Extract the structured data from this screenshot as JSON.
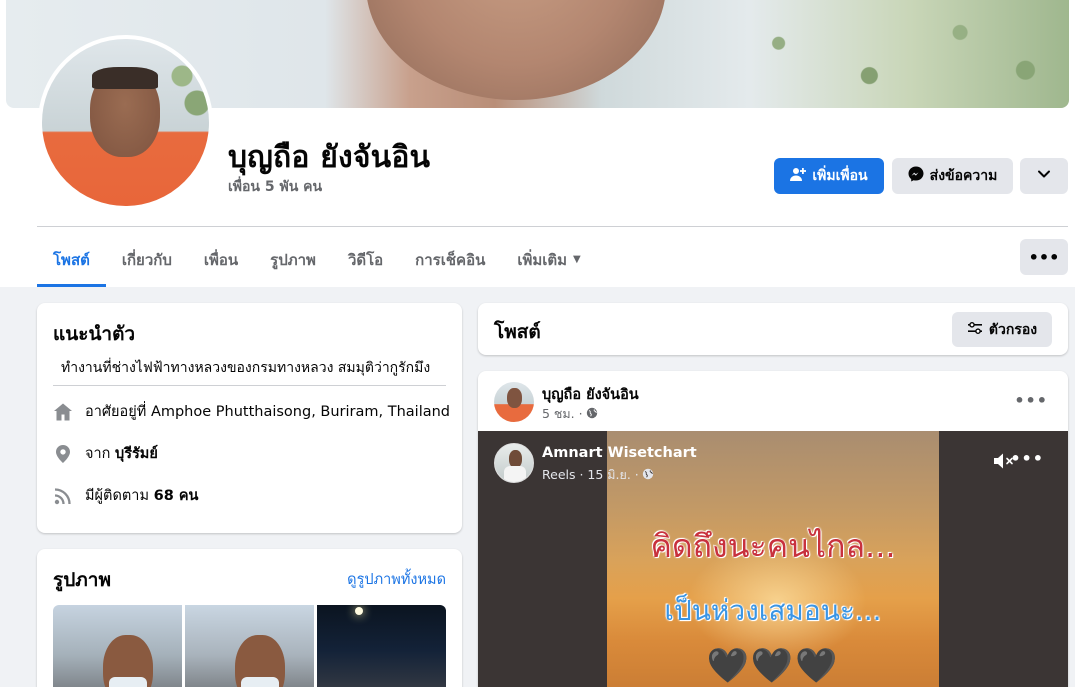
{
  "profile": {
    "name": "บุญถือ ยังจันอิน",
    "friends_count": "เพื่อน 5 พัน คน",
    "add_friend_label": "เพิ่มเพื่อน",
    "message_label": "ส่งข้อความ"
  },
  "tabs": [
    {
      "label": "โพสต์",
      "active": true
    },
    {
      "label": "เกี่ยวกับ"
    },
    {
      "label": "เพื่อน"
    },
    {
      "label": "รูปภาพ"
    },
    {
      "label": "วิดีโอ"
    },
    {
      "label": "การเช็คอิน"
    },
    {
      "label": "เพิ่มเติม"
    }
  ],
  "intro": {
    "title": "แนะนำตัว",
    "bio": "ทำงานที่ช่างไฟฟ้าทางหลวงของกรมทางหลวง สมมุติว่ากูรักมึง",
    "lives_prefix": "อาศัยอยู่ที่",
    "lives_place": "Amphoe Phutthaisong, Buriram, Thailand",
    "from_prefix": "จาก",
    "from_place": "บุรีรัมย์",
    "followers_prefix": "มีผู้ติดตาม",
    "followers_count": "68 คน"
  },
  "photos": {
    "title": "รูปภาพ",
    "see_all": "ดูรูปภาพทั้งหมด"
  },
  "posts_header": {
    "title": "โพสต์",
    "filter_label": "ตัวกรอง"
  },
  "post": {
    "author": "บุญถือ ยังจันอิน",
    "time": "5 ชม. ·",
    "reel": {
      "author": "Amnart Wisetchart",
      "meta": "Reels · 15 มิ.ย. ·",
      "line1": "คิดถึงนะคนไกล...",
      "line2": "เป็นห่วงเสมอนะ...",
      "hearts": "🖤🖤🖤"
    }
  },
  "colors": {
    "accent": "#1b74e4",
    "page_bg": "#f0f2f5",
    "muted_text": "#65676b"
  }
}
